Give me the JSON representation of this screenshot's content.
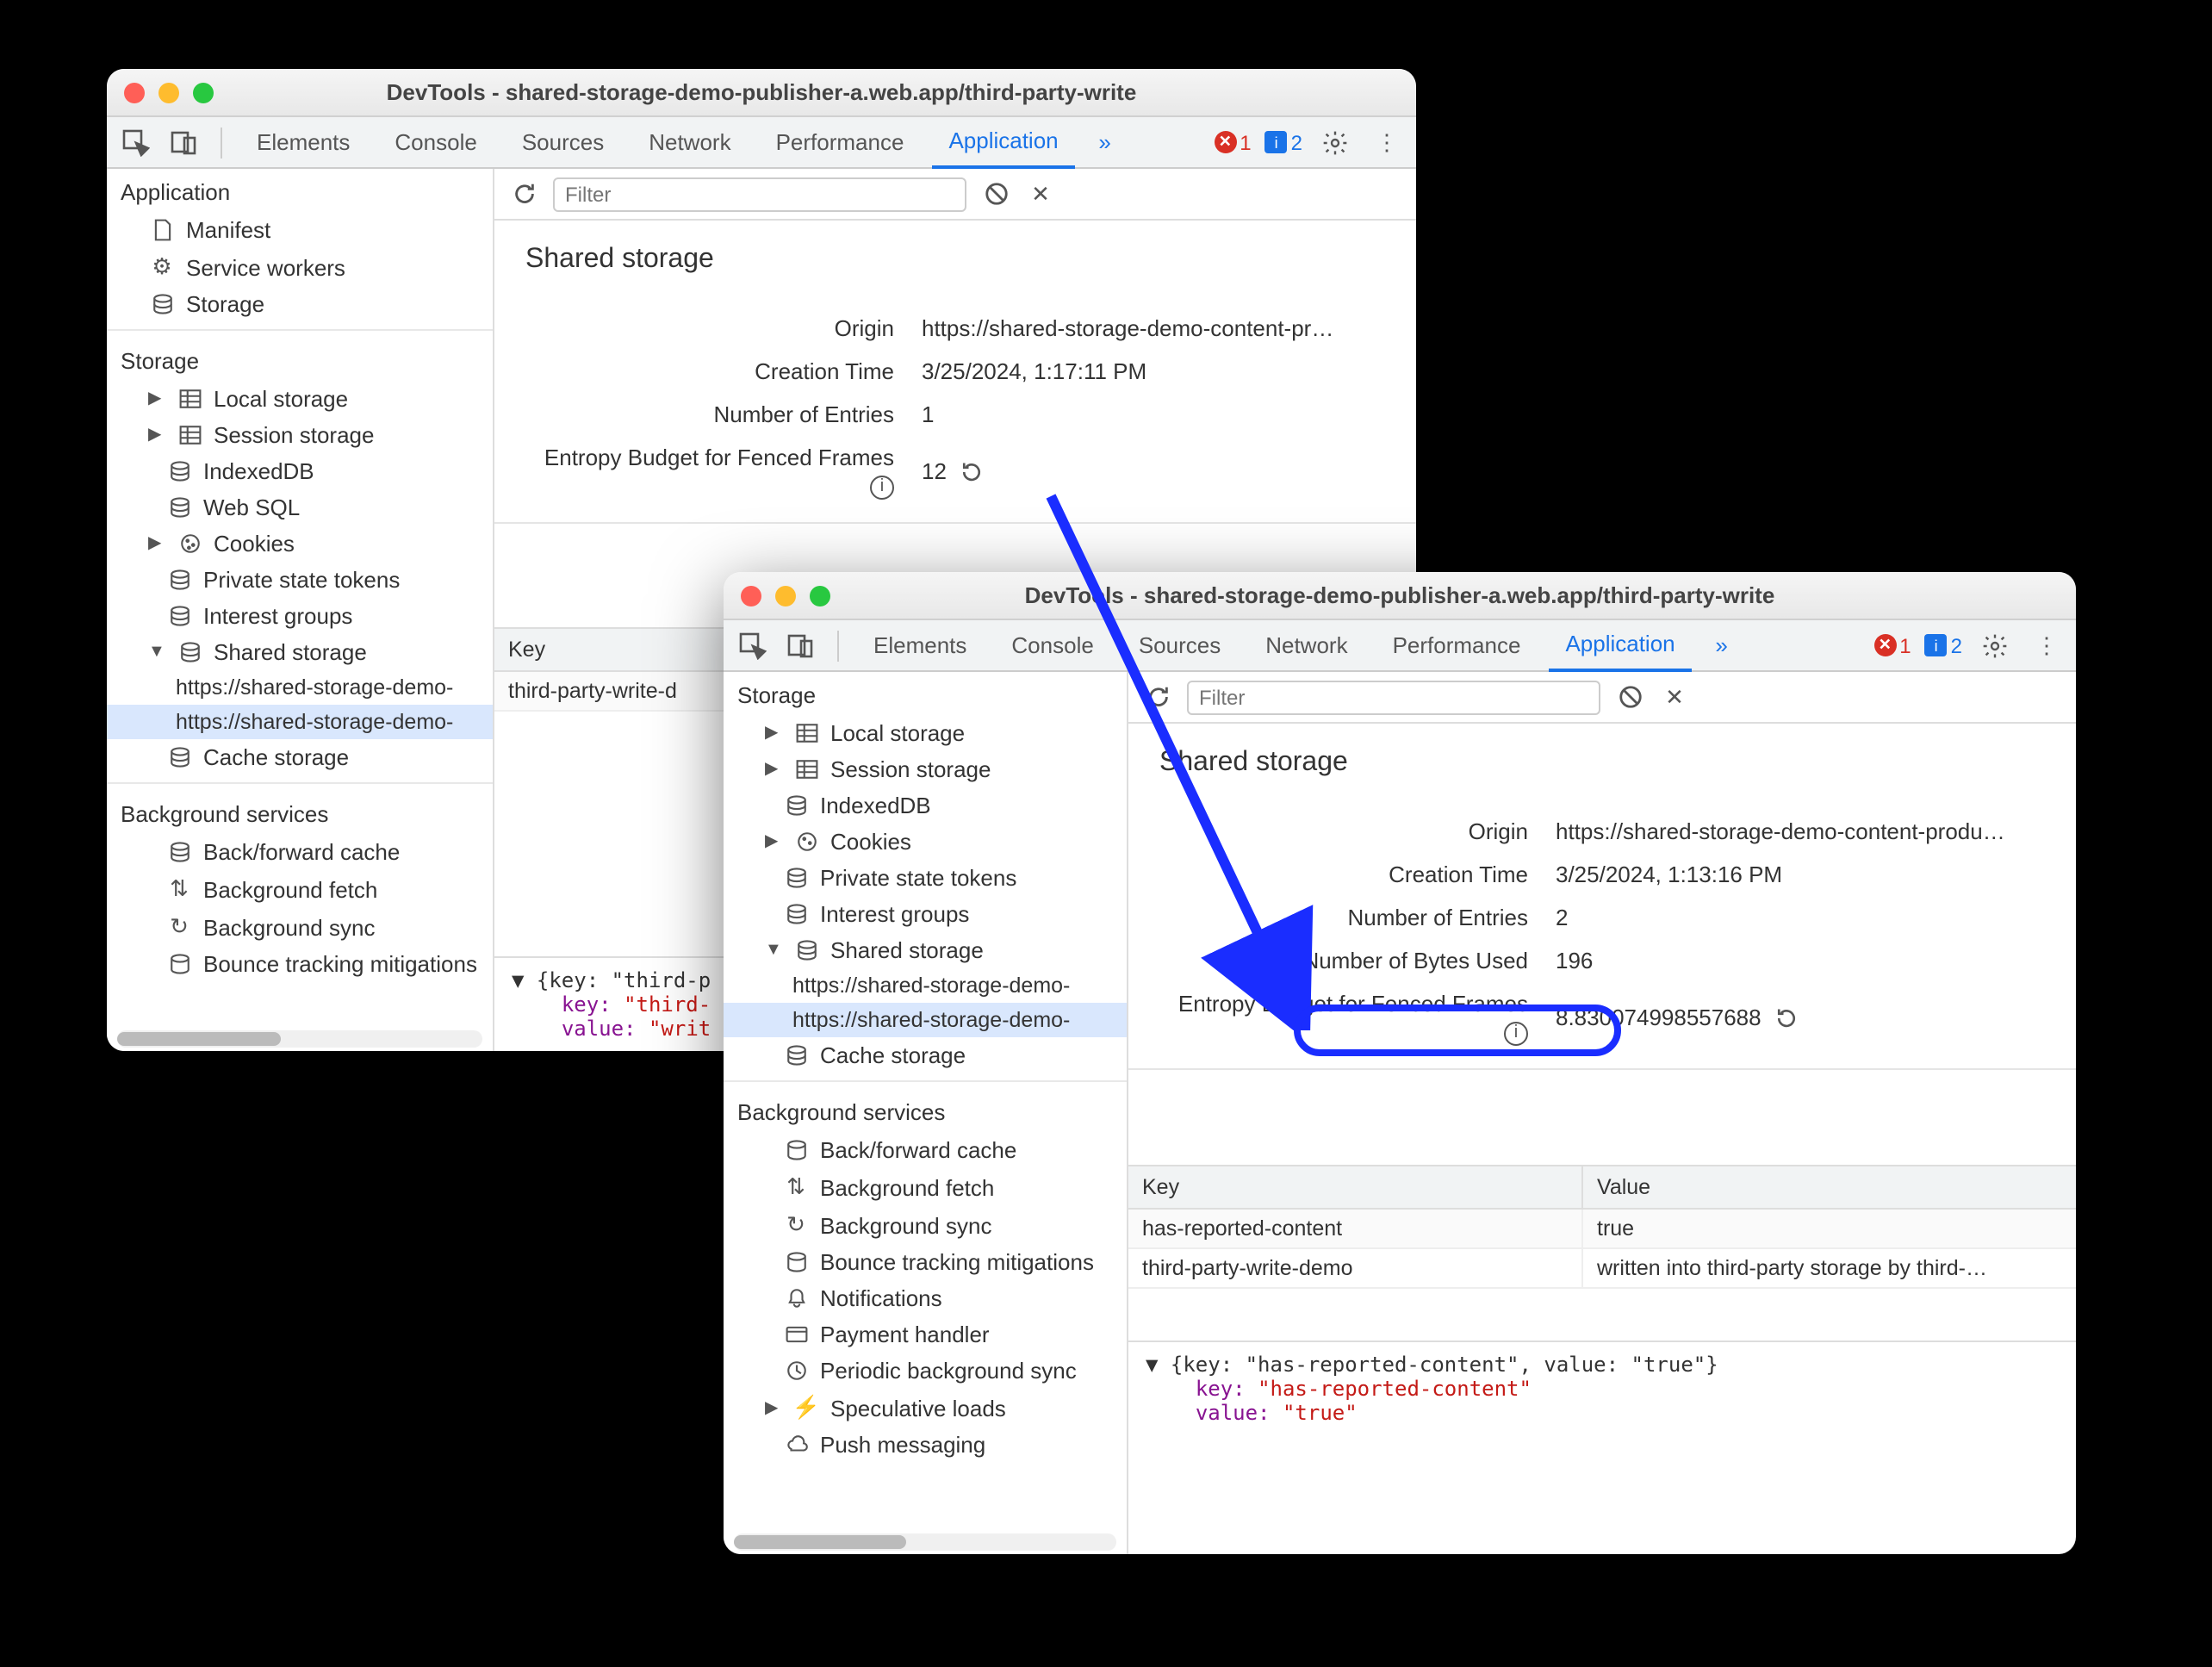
{
  "back": {
    "title": "DevTools - shared-storage-demo-publisher-a.web.app/third-party-write",
    "tabs": [
      "Elements",
      "Console",
      "Sources",
      "Network",
      "Performance",
      "Application"
    ],
    "activeTab": "Application",
    "errors": "1",
    "messages": "2",
    "filter_placeholder": "Filter",
    "sidebar": {
      "app_title": "Application",
      "app_items": [
        "Manifest",
        "Service workers",
        "Storage"
      ],
      "storage_title": "Storage",
      "local": "Local storage",
      "session": "Session storage",
      "indexed": "IndexedDB",
      "websql": "Web SQL",
      "cookies": "Cookies",
      "tokens": "Private state tokens",
      "interest": "Interest groups",
      "shared": "Shared storage",
      "shared_children": [
        "https://shared-storage-demo-",
        "https://shared-storage-demo-"
      ],
      "cache": "Cache storage",
      "bg_title": "Background services",
      "bfcache": "Back/forward cache",
      "bgfetch": "Background fetch",
      "bgsync": "Background sync",
      "bounce": "Bounce tracking mitigations"
    },
    "panel": {
      "heading": "Shared storage",
      "origin_l": "Origin",
      "origin_v": "https://shared-storage-demo-content-pr…",
      "ctime_l": "Creation Time",
      "ctime_v": "3/25/2024, 1:17:11 PM",
      "entries_l": "Number of Entries",
      "entries_v": "1",
      "budget_l": "Entropy Budget for Fenced Frames",
      "budget_v": "12"
    },
    "grid": {
      "key_h": "Key",
      "row0_k": "third-party-write-d"
    },
    "detail": {
      "l0": "▼ {key: \"third-p",
      "l1": "key: ",
      "l1v": "\"third-",
      "l2": "value: ",
      "l2v": "\"writ"
    }
  },
  "front": {
    "title": "DevTools - shared-storage-demo-publisher-a.web.app/third-party-write",
    "tabs": [
      "Elements",
      "Console",
      "Sources",
      "Network",
      "Performance",
      "Application"
    ],
    "activeTab": "Application",
    "errors": "1",
    "messages": "2",
    "filter_placeholder": "Filter",
    "sidebar": {
      "storage_title": "Storage",
      "local": "Local storage",
      "session": "Session storage",
      "indexed": "IndexedDB",
      "cookies": "Cookies",
      "tokens": "Private state tokens",
      "interest": "Interest groups",
      "shared": "Shared storage",
      "shared_children": [
        "https://shared-storage-demo-",
        "https://shared-storage-demo-"
      ],
      "cache": "Cache storage",
      "bg_title": "Background services",
      "bfcache": "Back/forward cache",
      "bgfetch": "Background fetch",
      "bgsync": "Background sync",
      "bounce": "Bounce tracking mitigations",
      "notif": "Notifications",
      "payment": "Payment handler",
      "periodic": "Periodic background sync",
      "spec": "Speculative loads",
      "push": "Push messaging"
    },
    "panel": {
      "heading": "Shared storage",
      "origin_l": "Origin",
      "origin_v": "https://shared-storage-demo-content-produ…",
      "ctime_l": "Creation Time",
      "ctime_v": "3/25/2024, 1:13:16 PM",
      "entries_l": "Number of Entries",
      "entries_v": "2",
      "bytes_l": "Number of Bytes Used",
      "bytes_v": "196",
      "budget_l": "Entropy Budget for Fenced Frames",
      "budget_v": "8.830074998557688"
    },
    "grid": {
      "key_h": "Key",
      "val_h": "Value",
      "r0k": "has-reported-content",
      "r0v": "true",
      "r1k": "third-party-write-demo",
      "r1v": "written into third-party storage by third-…"
    },
    "detail": {
      "l0": "▼ {key: \"has-reported-content\", value: \"true\"}",
      "l1": "key: ",
      "l1v": "\"has-reported-content\"",
      "l2": "value: ",
      "l2v": "\"true\""
    }
  }
}
